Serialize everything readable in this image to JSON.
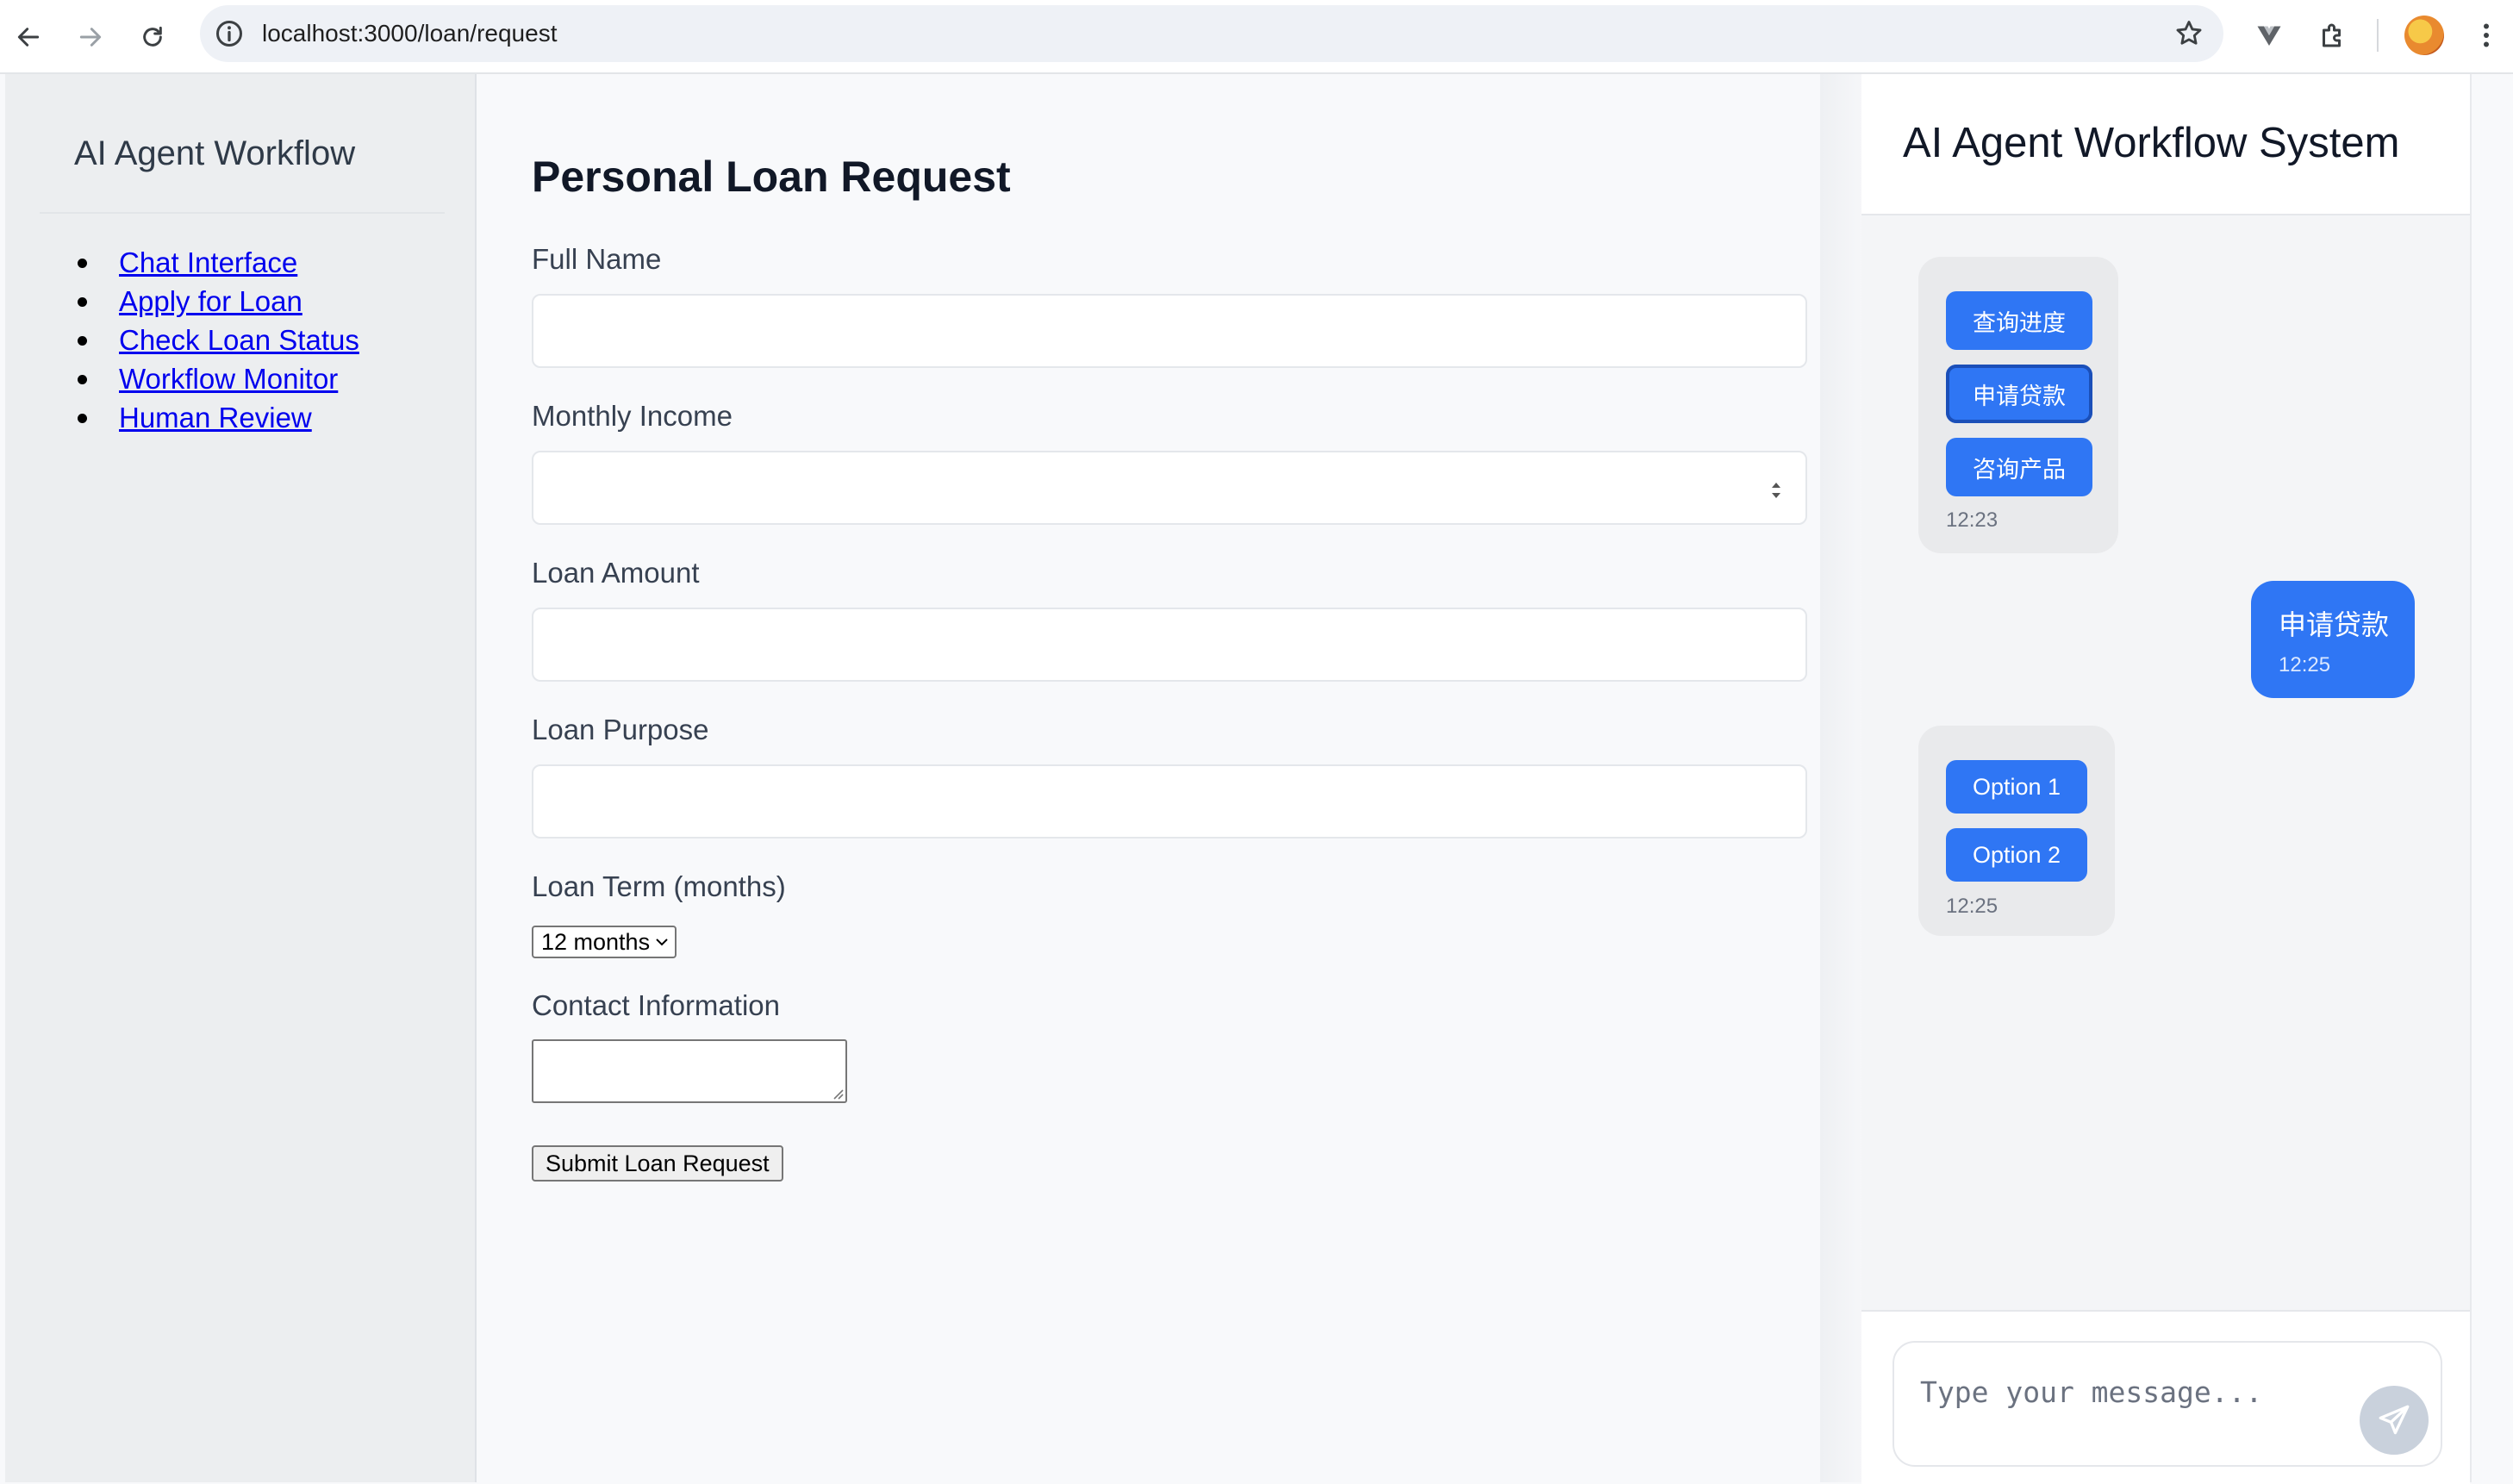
{
  "browser": {
    "url": "localhost:3000/loan/request"
  },
  "sidebar": {
    "title": "AI Agent Workflow",
    "items": [
      {
        "label": "Chat Interface"
      },
      {
        "label": "Apply for Loan"
      },
      {
        "label": "Check Loan Status"
      },
      {
        "label": "Workflow Monitor"
      },
      {
        "label": "Human Review"
      }
    ]
  },
  "form": {
    "title": "Personal Loan Request",
    "full_name_label": "Full Name",
    "full_name_value": "",
    "monthly_income_label": "Monthly Income",
    "monthly_income_value": "",
    "loan_amount_label": "Loan Amount",
    "loan_amount_value": "",
    "loan_purpose_label": "Loan Purpose",
    "loan_purpose_value": "",
    "loan_term_label": "Loan Term (months)",
    "loan_term_selected": "12 months",
    "contact_label": "Contact Information",
    "contact_value": "",
    "submit_label": "Submit Loan Request"
  },
  "chat": {
    "title": "AI Agent Workflow System",
    "messages": [
      {
        "sender": "bot",
        "options": [
          "查询进度",
          "申请贷款",
          "咨询产品"
        ],
        "active_option": "申请贷款",
        "time": "12:23"
      },
      {
        "sender": "user",
        "text": "申请贷款",
        "time": "12:25"
      },
      {
        "sender": "bot",
        "options": [
          "Option 1",
          "Option 2"
        ],
        "time": "12:25"
      }
    ],
    "input_placeholder": "Type your message..."
  },
  "colors": {
    "accent": "#2f76f4",
    "link": "#0000ee"
  }
}
